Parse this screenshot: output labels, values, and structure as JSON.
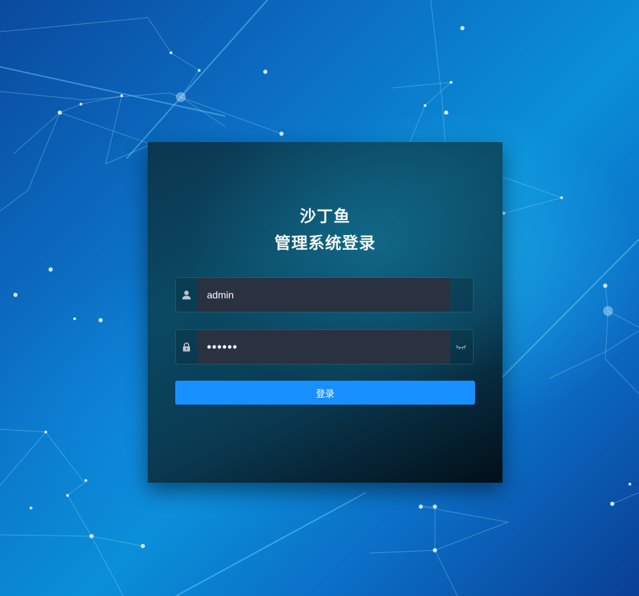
{
  "app": {
    "title_line1": "沙丁鱼",
    "title_line2": "管理系统登录"
  },
  "form": {
    "username": {
      "value": "admin",
      "icon": "user-icon"
    },
    "password": {
      "value": "••••••",
      "icon": "lock-icon",
      "toggle_icon": "eye-closed-icon"
    },
    "submit_label": "登录"
  },
  "colors": {
    "accent": "#1890ff",
    "input_bg": "#2a3141",
    "title_text": "#f3f6f8"
  }
}
